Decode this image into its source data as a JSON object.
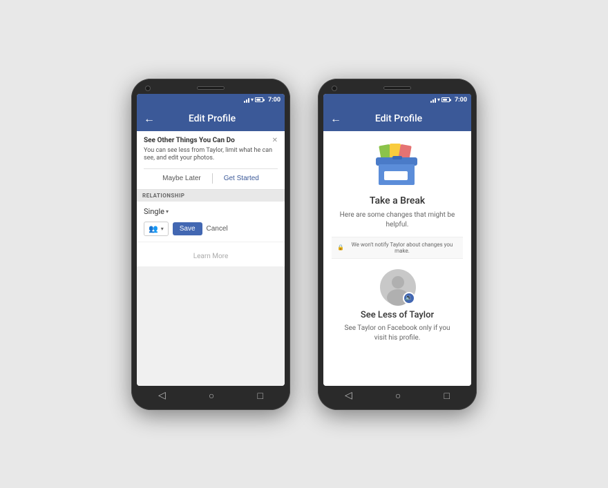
{
  "phones": [
    {
      "id": "left-phone",
      "statusBar": {
        "time": "7:00"
      },
      "appBar": {
        "title": "Edit Profile",
        "backArrow": "←"
      },
      "notification": {
        "title": "See Other Things You Can Do",
        "body": "You can see less from Taylor, limit what he can see, and edit your photos.",
        "maybeLater": "Maybe Later",
        "getStarted": "Get Started"
      },
      "sections": [
        {
          "label": "RELATIONSHIP"
        }
      ],
      "form": {
        "relationship": "Single",
        "saveLabel": "Save",
        "cancelLabel": "Cancel"
      },
      "learnMore": "Learn More"
    },
    {
      "id": "right-phone",
      "statusBar": {
        "time": "7:00"
      },
      "appBar": {
        "title": "Edit Profile",
        "backArrow": "←"
      },
      "takeABreak": {
        "title": "Take a Break",
        "subtitle": "Here are some changes that\nmight be helpful.",
        "privacyNote": "We won't notify Taylor about changes you make."
      },
      "seeLess": {
        "title": "See Less of Taylor",
        "description": "See Taylor on Facebook only\nif you visit his profile."
      }
    }
  ]
}
